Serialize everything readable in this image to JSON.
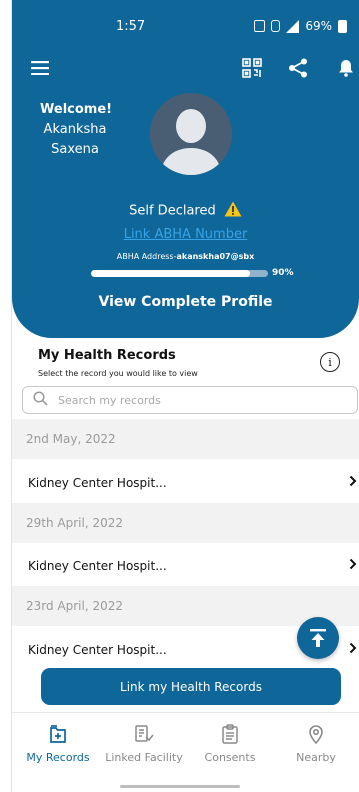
{
  "status_bar": {
    "time": "1:57",
    "battery": "69%"
  },
  "hero": {
    "welcome_title": "Welcome!",
    "first_name": "Akanksha",
    "last_name": "Saxena",
    "self_declared": "Self Declared",
    "link_abha": "Link ABHA Number",
    "abha_prefix": "ABHA Address-",
    "abha_value": "akanskha07@sbx",
    "profile_progress": 0.9,
    "profile_progress_label": "90%",
    "view_profile": "View Complete Profile"
  },
  "records": {
    "title": "My Health Records",
    "subtitle": "Select the record you would like to view",
    "search_placeholder": "Search my records",
    "groups": [
      {
        "date": "2nd May, 2022",
        "item": "Kidney Center Hospit..."
      },
      {
        "date": "29th April, 2022",
        "item": "Kidney Center Hospit..."
      },
      {
        "date": "23rd April, 2022",
        "item": "Kidney Center Hospit..."
      }
    ],
    "link_button": "Link my Health Records"
  },
  "bottom_nav": [
    {
      "label": "My Records",
      "icon": "records-icon",
      "active": true
    },
    {
      "label": "Linked Facility",
      "icon": "facility-icon",
      "active": false
    },
    {
      "label": "Consents",
      "icon": "consents-icon",
      "active": false
    },
    {
      "label": "Nearby",
      "icon": "location-pin-icon",
      "active": false
    }
  ],
  "colors": {
    "primary": "#0f6699",
    "link": "#37a3e6",
    "date_bg": "#f2f2f2"
  }
}
